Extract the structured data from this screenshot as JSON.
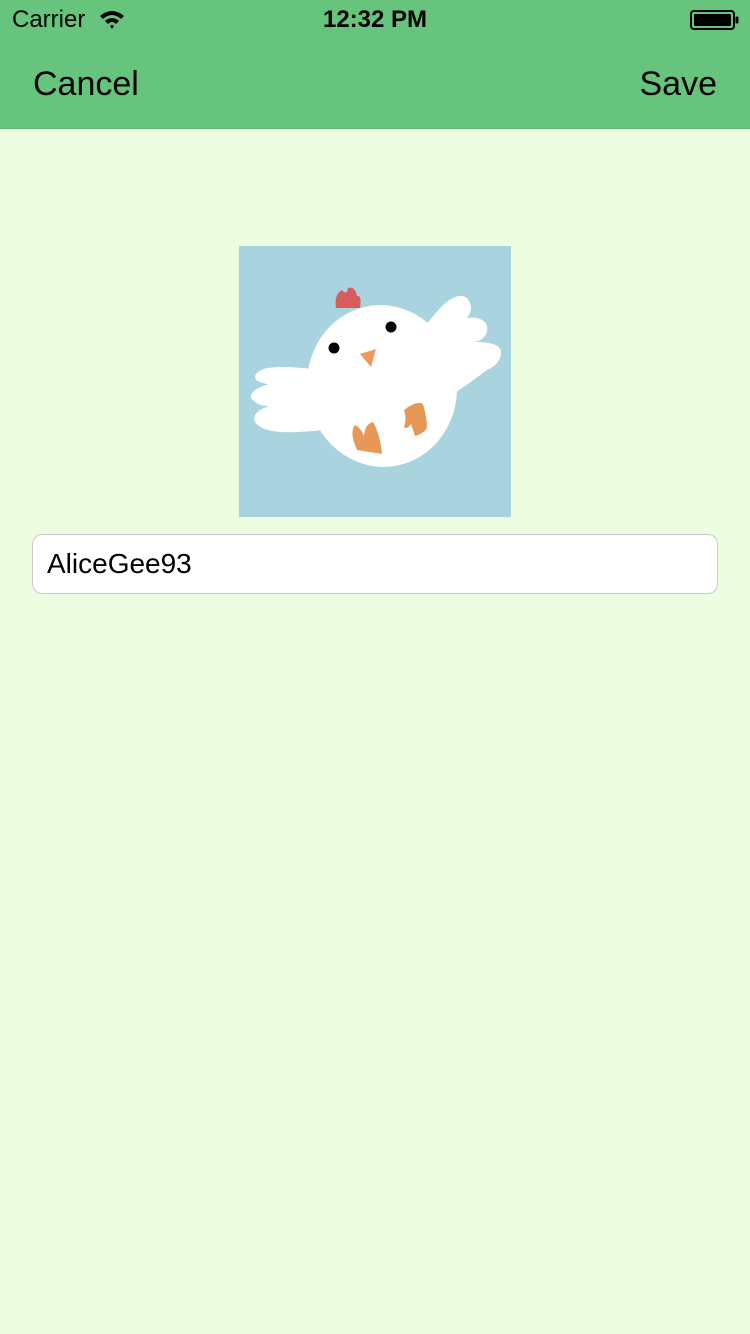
{
  "status_bar": {
    "carrier": "Carrier",
    "time": "12:32 PM",
    "wifi_icon": "wifi-icon",
    "battery_icon": "battery-icon"
  },
  "nav": {
    "cancel_label": "Cancel",
    "save_label": "Save",
    "background_color": "#67c47c"
  },
  "profile": {
    "avatar_icon": "chicken-avatar",
    "avatar_background": "#a9d3de",
    "username_value": "AliceGee93"
  },
  "colors": {
    "page_background": "#ecfde1",
    "nav_background": "#67c47c"
  }
}
